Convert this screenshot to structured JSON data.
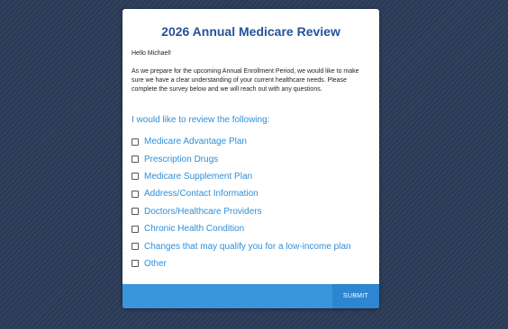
{
  "form": {
    "title": "2026 Annual Medicare Review",
    "greeting": "Hello Michael!",
    "intro": "As we prepare for the upcoming Annual Enrollment Period, we would like to make sure we have a clear understanding of your current healthcare needs. Please complete the survey below and we will reach out with any questions.",
    "question": "I would like to review the following:",
    "options": [
      {
        "label": "Medicare Advantage Plan",
        "checked": false
      },
      {
        "label": "Prescription Drugs",
        "checked": false
      },
      {
        "label": "Medicare Supplement Plan",
        "checked": false
      },
      {
        "label": "Address/Contact Information",
        "checked": false
      },
      {
        "label": "Doctors/Healthcare Providers",
        "checked": false
      },
      {
        "label": "Chronic Health Condition",
        "checked": false
      },
      {
        "label": "Changes that may qualify you for a low-income plan",
        "checked": false
      },
      {
        "label": "Other",
        "checked": false
      }
    ],
    "submit_label": "SUBMIT"
  },
  "colors": {
    "background": "#2b3b57",
    "title": "#24539a",
    "accent": "#2f8fd8",
    "footer": "#3a96db",
    "submit": "#2d86cf"
  }
}
